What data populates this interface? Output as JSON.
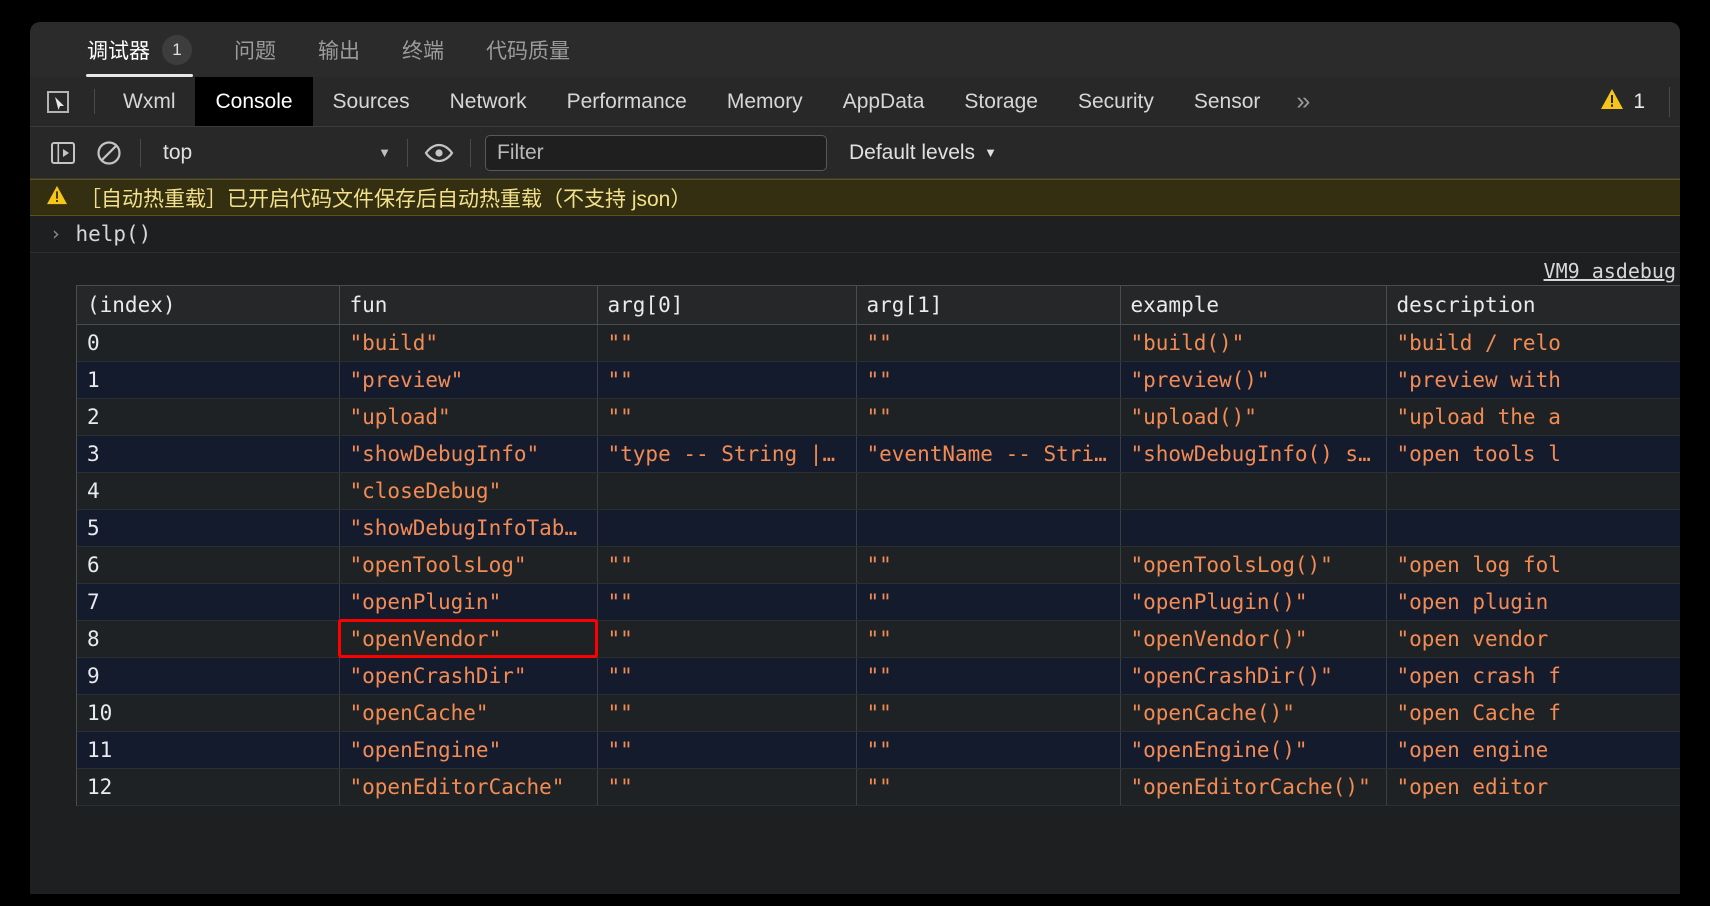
{
  "ide_tabs": [
    {
      "label": "调试器",
      "badge": "1",
      "active": true
    },
    {
      "label": "问题",
      "badge": "",
      "active": false
    },
    {
      "label": "输出",
      "badge": "",
      "active": false
    },
    {
      "label": "终端",
      "badge": "",
      "active": false
    },
    {
      "label": "代码质量",
      "badge": "",
      "active": false
    }
  ],
  "devtools": {
    "inspect_icon": "inspect-element-icon",
    "tabs": [
      {
        "label": "Wxml",
        "active": false
      },
      {
        "label": "Console",
        "active": true
      },
      {
        "label": "Sources",
        "active": false
      },
      {
        "label": "Network",
        "active": false
      },
      {
        "label": "Performance",
        "active": false
      },
      {
        "label": "Memory",
        "active": false
      },
      {
        "label": "AppData",
        "active": false
      },
      {
        "label": "Storage",
        "active": false
      },
      {
        "label": "Security",
        "active": false
      },
      {
        "label": "Sensor",
        "active": false
      }
    ],
    "more_tabs_icon": "chevron-double-right-icon",
    "warning_icon": "warning-triangle-icon",
    "warning_count": "1"
  },
  "toolbar": {
    "sidebar_icon": "show-console-sidebar-icon",
    "clear_icon": "clear-console-icon",
    "context": "top",
    "context_caret": "▼",
    "eye_icon": "live-expression-eye-icon",
    "filter_placeholder": "Filter",
    "filter_value": "",
    "levels_label": "Default levels",
    "levels_caret": "▼"
  },
  "console": {
    "warning_icon": "warning-triangle-icon",
    "warning_message": "［自动热重载］已开启代码文件保存后自动热重载（不支持 json）",
    "prompt_chevron": "›",
    "input_expression": "help()",
    "vm_link": "VM9 asdebug"
  },
  "table": {
    "columns": [
      "(index)",
      "fun",
      "arg[0]",
      "arg[1]",
      "example",
      "description"
    ],
    "rows": [
      {
        "index": "0",
        "fun": "\"build\"",
        "arg0": "\"\"",
        "arg1": "\"\"",
        "example": "\"build()\"",
        "description": "\"build / relo"
      },
      {
        "index": "1",
        "fun": "\"preview\"",
        "arg0": "\"\"",
        "arg1": "\"\"",
        "example": "\"preview()\"",
        "description": "\"preview with"
      },
      {
        "index": "2",
        "fun": "\"upload\"",
        "arg0": "\"\"",
        "arg1": "\"\"",
        "example": "\"upload()\"",
        "description": "\"upload the a"
      },
      {
        "index": "3",
        "fun": "\"showDebugInfo\"",
        "arg0": "\"type -- String ||…",
        "arg1": "\"eventName -- Strin…",
        "example": "\"showDebugInfo() s…",
        "description": "\"open tools l"
      },
      {
        "index": "4",
        "fun": "\"closeDebug\"",
        "arg0": "",
        "arg1": "",
        "example": "",
        "description": ""
      },
      {
        "index": "5",
        "fun": "\"showDebugInfoTabl…",
        "arg0": "",
        "arg1": "",
        "example": "",
        "description": ""
      },
      {
        "index": "6",
        "fun": "\"openToolsLog\"",
        "arg0": "\"\"",
        "arg1": "\"\"",
        "example": "\"openToolsLog()\"",
        "description": "\"open log fol"
      },
      {
        "index": "7",
        "fun": "\"openPlugin\"",
        "arg0": "\"\"",
        "arg1": "\"\"",
        "example": "\"openPlugin()\"",
        "description": "\"open plugin "
      },
      {
        "index": "8",
        "fun": "\"openVendor\"",
        "arg0": "\"\"",
        "arg1": "\"\"",
        "example": "\"openVendor()\"",
        "description": "\"open vendor "
      },
      {
        "index": "9",
        "fun": "\"openCrashDir\"",
        "arg0": "\"\"",
        "arg1": "\"\"",
        "example": "\"openCrashDir()\"",
        "description": "\"open crash f"
      },
      {
        "index": "10",
        "fun": "\"openCache\"",
        "arg0": "\"\"",
        "arg1": "\"\"",
        "example": "\"openCache()\"",
        "description": "\"open Cache f"
      },
      {
        "index": "11",
        "fun": "\"openEngine\"",
        "arg0": "\"\"",
        "arg1": "\"\"",
        "example": "\"openEngine()\"",
        "description": "\"open engine "
      },
      {
        "index": "12",
        "fun": "\"openEditorCache\"",
        "arg0": "\"\"",
        "arg1": "\"\"",
        "example": "\"openEditorCache()\"",
        "description": "\"open editor "
      }
    ]
  },
  "annotation": {
    "target_row_index": 8,
    "target_column": "fun",
    "color": "#ff0000"
  }
}
